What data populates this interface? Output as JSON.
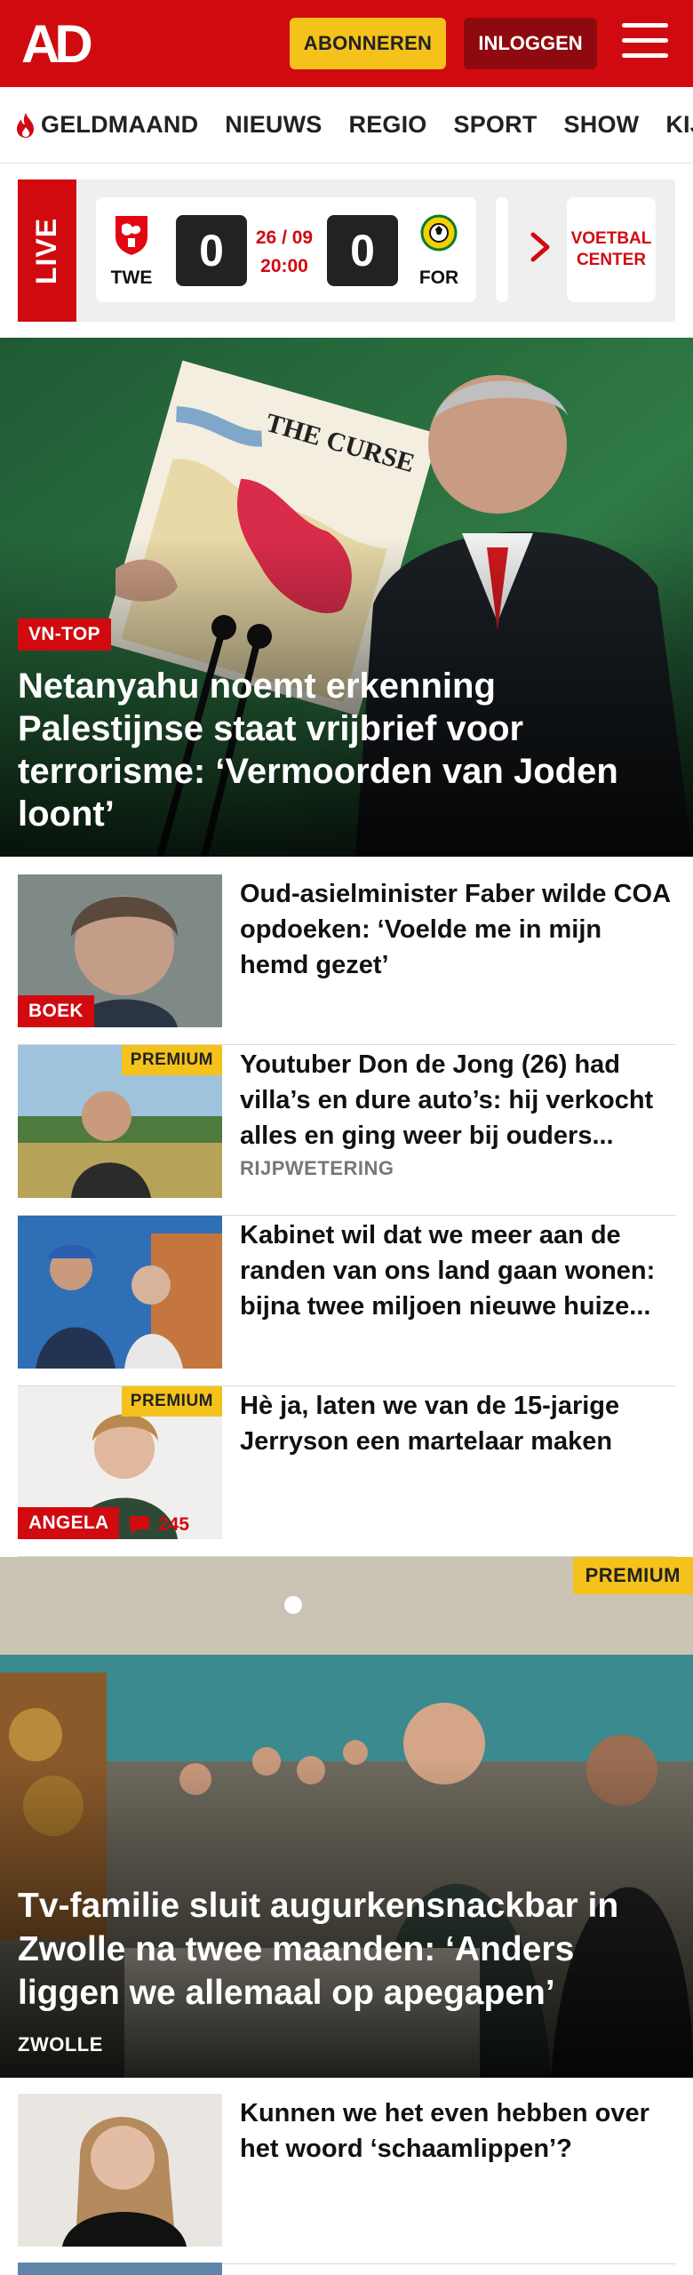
{
  "header": {
    "logo_text": "AD",
    "subscribe_label": "ABONNEREN",
    "login_label": "INLOGGEN",
    "menu_icon": "hamburger-menu-icon",
    "brand_color": "#d10a10",
    "accent_color": "#f5c21b"
  },
  "nav": {
    "items": [
      {
        "label": "GELDMAAND",
        "icon": "flame-icon"
      },
      {
        "label": "NIEUWS"
      },
      {
        "label": "REGIO"
      },
      {
        "label": "SPORT"
      },
      {
        "label": "SHOW"
      },
      {
        "label": "KIJK"
      }
    ]
  },
  "live": {
    "label": "LIVE",
    "match": {
      "home": "TWE",
      "home_score": "0",
      "away": "FOR",
      "away_score": "0",
      "date": "26 / 09",
      "time": "20:00"
    },
    "center_label": "VOETBAL CENTER"
  },
  "hero": {
    "tag": "VN-TOP",
    "title": "Netanyahu noemt erkenning Palestijnse staat vrijbrief voor terrorisme: ‘Vermoorden van Joden loont’",
    "image_text": "THE CURSE"
  },
  "articles": [
    {
      "title": "Oud-asielminister Faber wilde COA opdoeken: ‘Voelde me in mijn hemd gezet’",
      "tag": "BOEK"
    },
    {
      "title": "Youtuber Don de Jong (26) had villa’s en dure auto’s: hij verkocht alles en ging weer bij ouders...",
      "location": "RIJPWETERING",
      "premium": "PREMIUM"
    },
    {
      "title": "Kabinet wil dat we meer aan de randen van ons land gaan wonen: bijna twee miljoen nieuwe huize..."
    },
    {
      "title": "Hè ja, laten we van de 15-jarige Jerryson een martelaar maken",
      "tag": "ANGELA",
      "premium": "PREMIUM",
      "comments": "245"
    }
  ],
  "feature": {
    "premium": "PREMIUM",
    "title": "Tv-familie sluit augurkensnackbar in Zwolle na twee maanden: ‘Anders liggen we allemaal op apegapen’",
    "location": "ZWOLLE"
  },
  "articles2": [
    {
      "title": "Kunnen we het even hebben over het woord ‘schaamlippen’?"
    }
  ]
}
